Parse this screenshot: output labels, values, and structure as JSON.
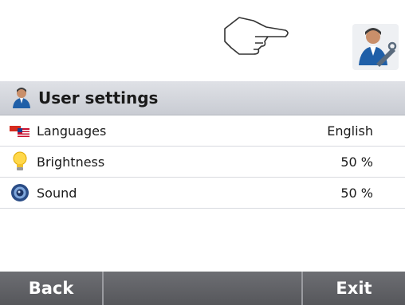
{
  "header": {
    "title": "User settings",
    "icon": "user-icon"
  },
  "toolbar": {
    "hand_icon": "pointing-hand-icon",
    "user_icon": "user-settings-icon"
  },
  "settings": [
    {
      "label": "Languages",
      "value": "English",
      "icon": "flags-icon"
    },
    {
      "label": "Brightness",
      "value": "50 %",
      "icon": "lightbulb-icon"
    },
    {
      "label": "Sound",
      "value": "50 %",
      "icon": "speaker-icon"
    }
  ],
  "footer": {
    "back_label": "Back",
    "middle_label": "",
    "exit_label": "Exit"
  },
  "colors": {
    "header_bg": "#d4d7dd",
    "footer_bg": "#5f6064",
    "row_divider": "#d8dadf"
  }
}
